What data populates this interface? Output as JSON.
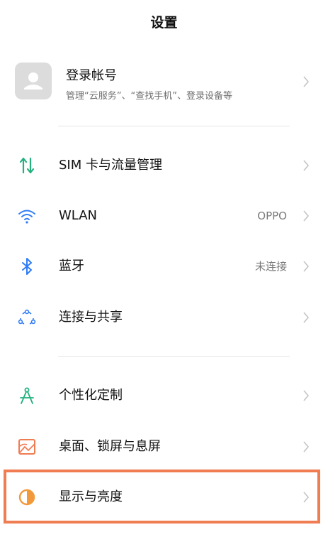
{
  "header": {
    "title": "设置"
  },
  "account": {
    "title": "登录帐号",
    "subtitle": "管理“云服务”、“查找手机”、登录设备等"
  },
  "items": [
    {
      "label": "SIM 卡与流量管理",
      "value": "",
      "icon": "sim-data-icon"
    },
    {
      "label": "WLAN",
      "value": "OPPO",
      "icon": "wifi-icon"
    },
    {
      "label": "蓝牙",
      "value": "未连接",
      "icon": "bluetooth-icon"
    },
    {
      "label": "连接与共享",
      "value": "",
      "icon": "connection-share-icon"
    },
    {
      "label": "个性化定制",
      "value": "",
      "icon": "personalize-icon"
    },
    {
      "label": "桌面、锁屏与息屏",
      "value": "",
      "icon": "wallpaper-icon"
    },
    {
      "label": "显示与亮度",
      "value": "",
      "icon": "display-brightness-icon"
    }
  ],
  "colors": {
    "accent_green": "#22b07d",
    "accent_blue": "#2f7cf6",
    "accent_orange": "#f07c52",
    "highlight": "#f07c52"
  }
}
